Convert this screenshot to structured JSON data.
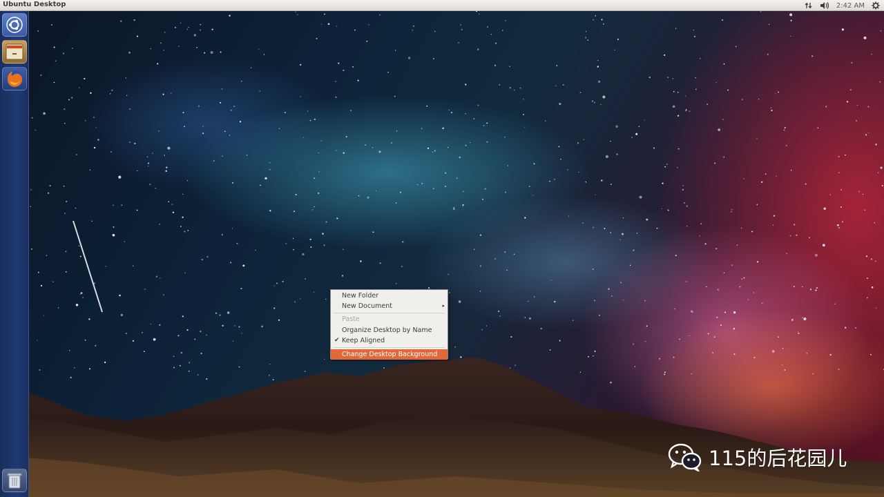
{
  "top_panel": {
    "window_title": "Ubuntu Desktop",
    "clock": "2:42 AM",
    "indicators": [
      "network-icon",
      "volume-icon",
      "gear-icon"
    ]
  },
  "launcher": {
    "items": [
      {
        "name": "dash",
        "icon": "ubuntu-logo-icon"
      },
      {
        "name": "files",
        "icon": "file-cabinet-icon"
      },
      {
        "name": "firefox",
        "icon": "firefox-icon"
      },
      {
        "name": "trash",
        "icon": "trash-icon"
      }
    ]
  },
  "context_menu": {
    "new_folder": "New Folder",
    "new_document": "New Document",
    "paste": "Paste",
    "organize": "Organize Desktop by Name",
    "keep_aligned": "Keep Aligned",
    "change_bg": "Change Desktop Background",
    "submenu_arrow": "▸",
    "check": "✔"
  },
  "watermark": {
    "text": "115的后花园儿",
    "icon": "wechat-icon"
  },
  "colors": {
    "menu_highlight": "#e2683a",
    "panel_bg": "#dfdcd6",
    "launcher_bg": "#203a72"
  }
}
